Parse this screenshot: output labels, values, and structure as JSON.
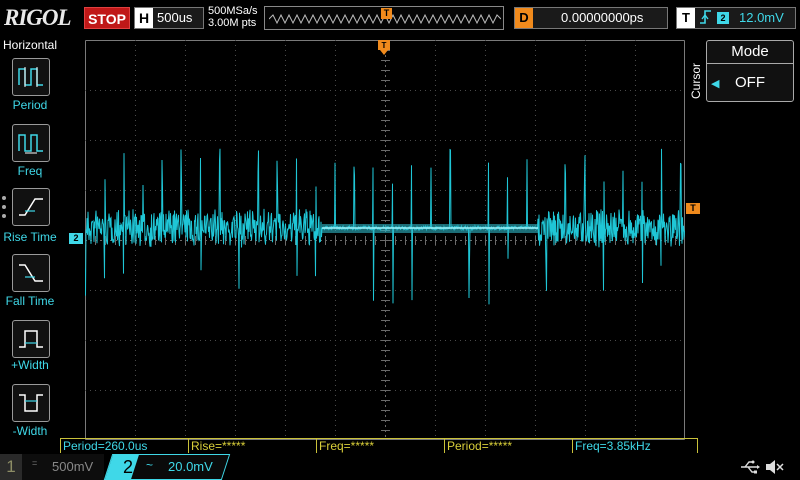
{
  "header": {
    "logo": "RIGOL",
    "run_state": "STOP",
    "horizontal_label": "H",
    "timebase": "500us",
    "sample_rate": "500MSa/s",
    "memory_depth": "3.00M pts",
    "trigger_marker": "T",
    "delay_label": "D",
    "delay_value": "0.00000000ps",
    "trigger_label": "T",
    "trigger_edge": "rising-edge-icon",
    "trigger_source": "2",
    "trigger_level": "12.0mV"
  },
  "left_menu": {
    "title": "Horizontal",
    "items": [
      {
        "label": "Period",
        "icon": "period-icon"
      },
      {
        "label": "Freq",
        "icon": "freq-icon"
      },
      {
        "label": "Rise Time",
        "icon": "rise-time-icon"
      },
      {
        "label": "Fall Time",
        "icon": "fall-time-icon"
      },
      {
        "label": "+Width",
        "icon": "positive-width-icon"
      },
      {
        "label": "-Width",
        "icon": "negative-width-icon"
      }
    ]
  },
  "right_menu": {
    "vertical_label": "Cursor",
    "mode_title": "Mode",
    "mode_value": "OFF"
  },
  "markers": {
    "channel2": "2",
    "trigger_right": "T"
  },
  "measurements": [
    {
      "text": "Period=260.0us",
      "color": "#3fd8e8"
    },
    {
      "text": "Rise=*****",
      "color": "#d9cf3a"
    },
    {
      "text": "Freq=*****",
      "color": "#d9cf3a"
    },
    {
      "text": "Period=*****",
      "color": "#d9cf3a"
    },
    {
      "text": "Freq=3.85kHz",
      "color": "#3fd8e8"
    }
  ],
  "channels": {
    "ch1": {
      "number": "1",
      "coupling": "=",
      "scale": "500mV"
    },
    "ch2": {
      "number": "2",
      "coupling": "~",
      "scale": "20.0mV"
    }
  },
  "status_icons": [
    "usb-icon",
    "speaker-mute-icon"
  ],
  "colors": {
    "ch2": "#3fd8e8",
    "trigger": "#f08a1c",
    "stop": "#c01818",
    "measure_border": "#c9c13a"
  }
}
